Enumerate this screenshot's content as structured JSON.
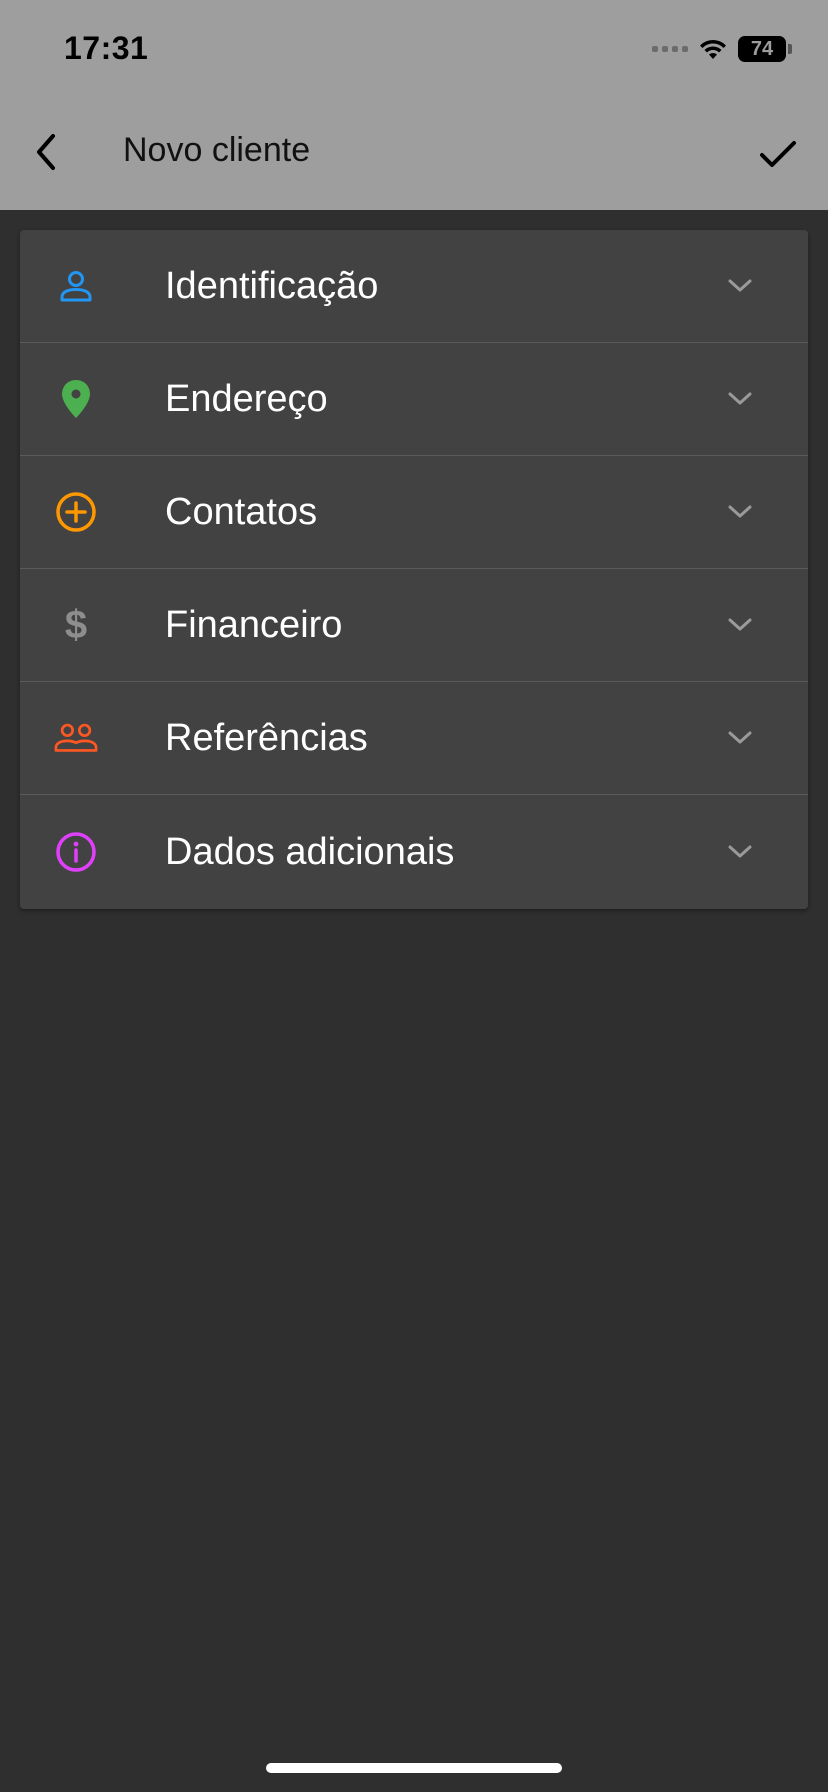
{
  "status_bar": {
    "time": "17:31",
    "battery": "74"
  },
  "header": {
    "title": "Novo cliente",
    "back_icon": "chevron-left-icon",
    "confirm_icon": "check-icon"
  },
  "sections": [
    {
      "label": "Identificação",
      "icon": "person-icon",
      "color": "#2196f3"
    },
    {
      "label": "Endereço",
      "icon": "location-pin-icon",
      "color": "#4caf50"
    },
    {
      "label": "Contatos",
      "icon": "add-circle-icon",
      "color": "#ff9800"
    },
    {
      "label": "Financeiro",
      "icon": "dollar-icon",
      "color": "#8e8e8e"
    },
    {
      "label": "Referências",
      "icon": "people-icon",
      "color": "#ff5722"
    },
    {
      "label": "Dados adicionais",
      "icon": "info-icon",
      "color": "#e040fb"
    }
  ],
  "colors": {
    "header_bg": "#9e9e9e",
    "page_bg": "#2f2f2f",
    "card_bg": "#424242",
    "chevron": "#9a9a9a"
  }
}
